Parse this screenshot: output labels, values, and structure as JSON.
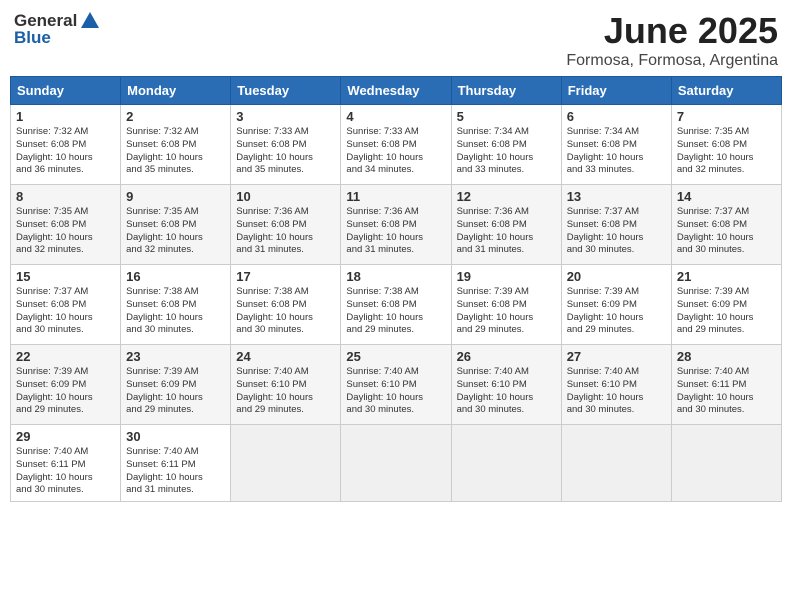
{
  "header": {
    "logo_general": "General",
    "logo_blue": "Blue",
    "month_year": "June 2025",
    "location": "Formosa, Formosa, Argentina"
  },
  "weekdays": [
    "Sunday",
    "Monday",
    "Tuesday",
    "Wednesday",
    "Thursday",
    "Friday",
    "Saturday"
  ],
  "weeks": [
    [
      {
        "day": "1",
        "info": "Sunrise: 7:32 AM\nSunset: 6:08 PM\nDaylight: 10 hours\nand 36 minutes."
      },
      {
        "day": "2",
        "info": "Sunrise: 7:32 AM\nSunset: 6:08 PM\nDaylight: 10 hours\nand 35 minutes."
      },
      {
        "day": "3",
        "info": "Sunrise: 7:33 AM\nSunset: 6:08 PM\nDaylight: 10 hours\nand 35 minutes."
      },
      {
        "day": "4",
        "info": "Sunrise: 7:33 AM\nSunset: 6:08 PM\nDaylight: 10 hours\nand 34 minutes."
      },
      {
        "day": "5",
        "info": "Sunrise: 7:34 AM\nSunset: 6:08 PM\nDaylight: 10 hours\nand 33 minutes."
      },
      {
        "day": "6",
        "info": "Sunrise: 7:34 AM\nSunset: 6:08 PM\nDaylight: 10 hours\nand 33 minutes."
      },
      {
        "day": "7",
        "info": "Sunrise: 7:35 AM\nSunset: 6:08 PM\nDaylight: 10 hours\nand 32 minutes."
      }
    ],
    [
      {
        "day": "8",
        "info": "Sunrise: 7:35 AM\nSunset: 6:08 PM\nDaylight: 10 hours\nand 32 minutes."
      },
      {
        "day": "9",
        "info": "Sunrise: 7:35 AM\nSunset: 6:08 PM\nDaylight: 10 hours\nand 32 minutes."
      },
      {
        "day": "10",
        "info": "Sunrise: 7:36 AM\nSunset: 6:08 PM\nDaylight: 10 hours\nand 31 minutes."
      },
      {
        "day": "11",
        "info": "Sunrise: 7:36 AM\nSunset: 6:08 PM\nDaylight: 10 hours\nand 31 minutes."
      },
      {
        "day": "12",
        "info": "Sunrise: 7:36 AM\nSunset: 6:08 PM\nDaylight: 10 hours\nand 31 minutes."
      },
      {
        "day": "13",
        "info": "Sunrise: 7:37 AM\nSunset: 6:08 PM\nDaylight: 10 hours\nand 30 minutes."
      },
      {
        "day": "14",
        "info": "Sunrise: 7:37 AM\nSunset: 6:08 PM\nDaylight: 10 hours\nand 30 minutes."
      }
    ],
    [
      {
        "day": "15",
        "info": "Sunrise: 7:37 AM\nSunset: 6:08 PM\nDaylight: 10 hours\nand 30 minutes."
      },
      {
        "day": "16",
        "info": "Sunrise: 7:38 AM\nSunset: 6:08 PM\nDaylight: 10 hours\nand 30 minutes."
      },
      {
        "day": "17",
        "info": "Sunrise: 7:38 AM\nSunset: 6:08 PM\nDaylight: 10 hours\nand 30 minutes."
      },
      {
        "day": "18",
        "info": "Sunrise: 7:38 AM\nSunset: 6:08 PM\nDaylight: 10 hours\nand 29 minutes."
      },
      {
        "day": "19",
        "info": "Sunrise: 7:39 AM\nSunset: 6:08 PM\nDaylight: 10 hours\nand 29 minutes."
      },
      {
        "day": "20",
        "info": "Sunrise: 7:39 AM\nSunset: 6:09 PM\nDaylight: 10 hours\nand 29 minutes."
      },
      {
        "day": "21",
        "info": "Sunrise: 7:39 AM\nSunset: 6:09 PM\nDaylight: 10 hours\nand 29 minutes."
      }
    ],
    [
      {
        "day": "22",
        "info": "Sunrise: 7:39 AM\nSunset: 6:09 PM\nDaylight: 10 hours\nand 29 minutes."
      },
      {
        "day": "23",
        "info": "Sunrise: 7:39 AM\nSunset: 6:09 PM\nDaylight: 10 hours\nand 29 minutes."
      },
      {
        "day": "24",
        "info": "Sunrise: 7:40 AM\nSunset: 6:10 PM\nDaylight: 10 hours\nand 29 minutes."
      },
      {
        "day": "25",
        "info": "Sunrise: 7:40 AM\nSunset: 6:10 PM\nDaylight: 10 hours\nand 30 minutes."
      },
      {
        "day": "26",
        "info": "Sunrise: 7:40 AM\nSunset: 6:10 PM\nDaylight: 10 hours\nand 30 minutes."
      },
      {
        "day": "27",
        "info": "Sunrise: 7:40 AM\nSunset: 6:10 PM\nDaylight: 10 hours\nand 30 minutes."
      },
      {
        "day": "28",
        "info": "Sunrise: 7:40 AM\nSunset: 6:11 PM\nDaylight: 10 hours\nand 30 minutes."
      }
    ],
    [
      {
        "day": "29",
        "info": "Sunrise: 7:40 AM\nSunset: 6:11 PM\nDaylight: 10 hours\nand 30 minutes."
      },
      {
        "day": "30",
        "info": "Sunrise: 7:40 AM\nSunset: 6:11 PM\nDaylight: 10 hours\nand 31 minutes."
      },
      {
        "day": "",
        "info": ""
      },
      {
        "day": "",
        "info": ""
      },
      {
        "day": "",
        "info": ""
      },
      {
        "day": "",
        "info": ""
      },
      {
        "day": "",
        "info": ""
      }
    ]
  ]
}
